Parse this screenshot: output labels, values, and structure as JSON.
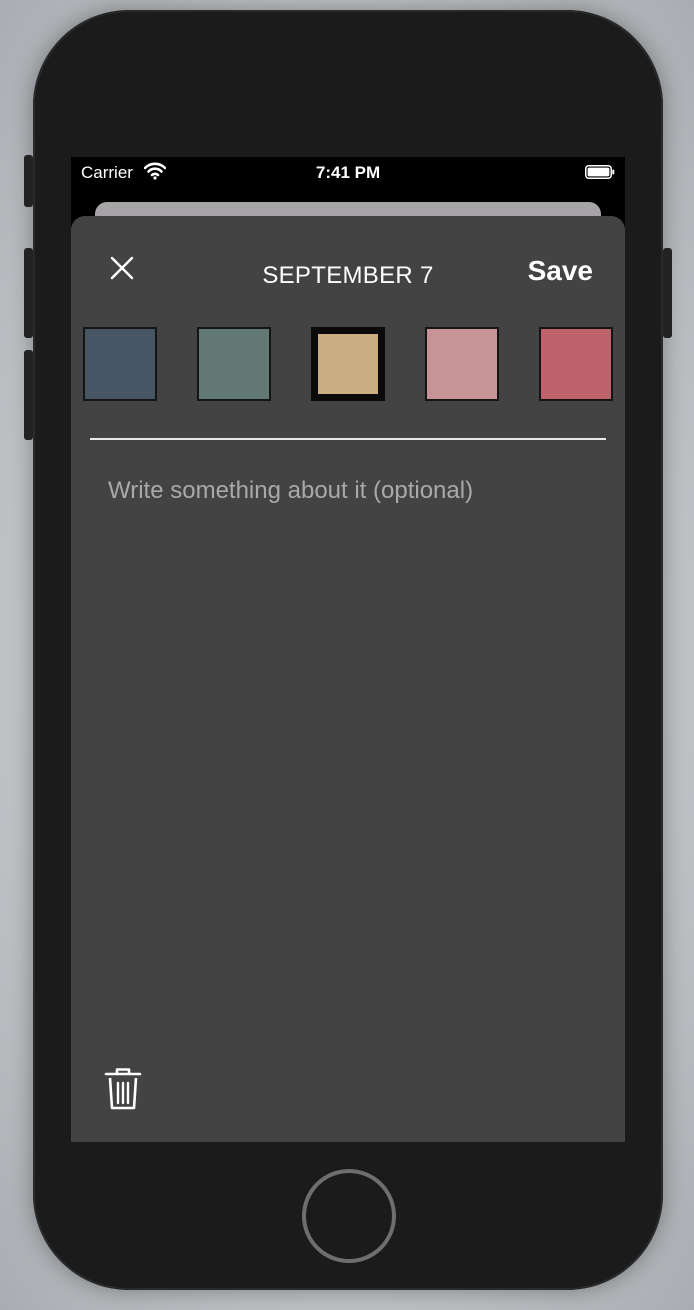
{
  "status_bar": {
    "carrier": "Carrier",
    "time": "7:41 PM",
    "wifi_icon": "wifi-icon",
    "battery_icon": "battery-icon"
  },
  "header": {
    "title": "SEPTEMBER 7",
    "save_label": "Save",
    "close_icon": "close-icon"
  },
  "colors": {
    "sheet_background": "#434343",
    "swatches": [
      {
        "color": "#475565",
        "selected": false
      },
      {
        "color": "#627873",
        "selected": false
      },
      {
        "color": "#c9ac80",
        "selected": true
      },
      {
        "color": "#c69496",
        "selected": false
      },
      {
        "color": "#be626b",
        "selected": false
      }
    ]
  },
  "note": {
    "value": "",
    "placeholder": "Write something about it (optional)"
  },
  "footer": {
    "delete_icon": "trash-icon"
  }
}
